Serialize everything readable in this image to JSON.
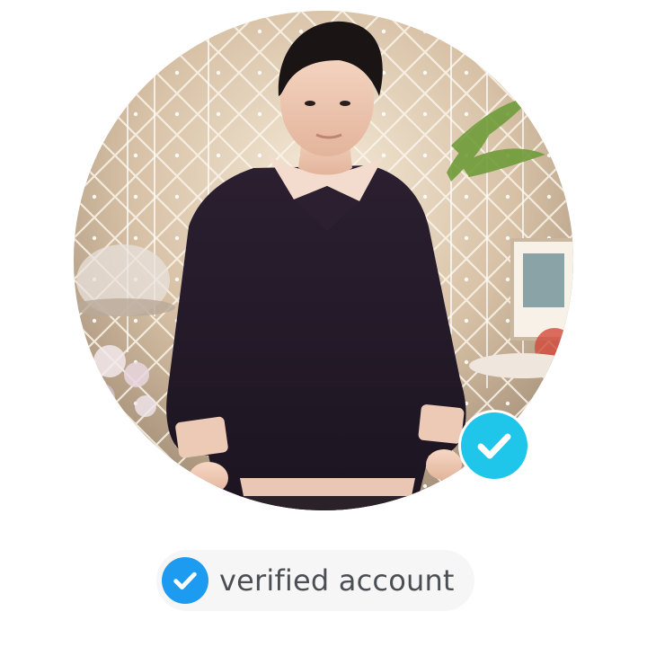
{
  "profile": {
    "photo_icon": "profile-photo",
    "verified_badge_icon": "verified-check-icon",
    "badge_color": "#20c5ea"
  },
  "verified_label": {
    "icon": "verified-check-icon",
    "icon_color": "#1d9bf0",
    "text": "verified account"
  }
}
